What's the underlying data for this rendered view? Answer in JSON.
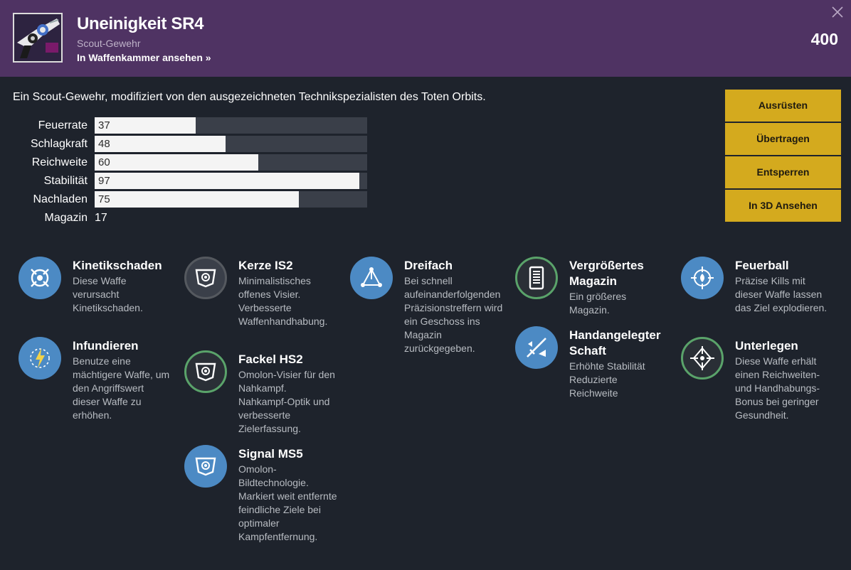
{
  "item": {
    "name": "Uneinigkeit SR4",
    "type": "Scout-Gewehr",
    "armory_link": "In Waffenkammer ansehen »",
    "power": "400",
    "description": "Ein Scout-Gewehr, modifiziert von den ausgezeichneten Technikspezialisten des Toten Orbits."
  },
  "stats": [
    {
      "name": "Feuerrate",
      "value": "37",
      "percent": 37
    },
    {
      "name": "Schlagkraft",
      "value": "48",
      "percent": 48
    },
    {
      "name": "Reichweite",
      "value": "60",
      "percent": 60
    },
    {
      "name": "Stabilität",
      "value": "97",
      "percent": 97
    },
    {
      "name": "Nachladen",
      "value": "75",
      "percent": 75
    }
  ],
  "magazine": {
    "name": "Magazin",
    "value": "17"
  },
  "actions": [
    "Ausrüsten",
    "Übertragen",
    "Entsperren",
    "In 3D Ansehen"
  ],
  "perks": {
    "col1": [
      {
        "name": "Kinetikschaden",
        "desc": "Diese Waffe verursacht Kinetikschaden.",
        "icon": "kinetic-icon"
      },
      {
        "name": "Infundieren",
        "desc": "Benutze eine mächtigere Waffe, um den Angriffswert dieser Waffe zu erhöhen.",
        "icon": "infuse-icon"
      }
    ],
    "col2": [
      {
        "name": "Kerze IS2",
        "desc": "Minimalistisches offenes Visier. Verbesserte Waffenhandhabung.",
        "icon": "sight-icon"
      },
      {
        "name": "Fackel HS2",
        "desc": "Omolon-Visier für den Nahkampf. Nahkampf-Optik und verbesserte Zielerfassung.",
        "icon": "sight-icon"
      },
      {
        "name": "Signal MS5",
        "desc": "Omolon-Bildtechnologie. Markiert weit entfernte feindliche Ziele bei optimaler Kampfentfernung.",
        "icon": "sight-icon"
      }
    ],
    "col3": [
      {
        "name": "Dreifach",
        "desc": "Bei schnell aufeinanderfolgenden Präzisionstreffern wird ein Geschoss ins Magazin zurückgegeben.",
        "icon": "triple-icon"
      }
    ],
    "col4": [
      {
        "name": "Vergrößertes Magazin",
        "desc": "Ein größeres Magazin.",
        "icon": "magazine-icon"
      },
      {
        "name": "Handangelegter Schaft",
        "desc": "Erhöhte Stabilität Reduzierte Reichweite",
        "icon": "stock-icon"
      }
    ],
    "col5": [
      {
        "name": "Feuerball",
        "desc": "Präzise Kills mit dieser Waffe lassen das Ziel explodieren.",
        "icon": "fireball-icon"
      },
      {
        "name": "Unterlegen",
        "desc": "Diese Waffe erhält einen Reichweiten- und Handhabungs-Bonus bei geringer Gesundheit.",
        "icon": "crosshair-icon"
      }
    ]
  },
  "colors": {
    "header": "#4f3363",
    "background": "#1e232c",
    "button": "#d4aa1e",
    "perk_blue": "#4c8ac4",
    "perk_selected": "#5aa36a"
  }
}
